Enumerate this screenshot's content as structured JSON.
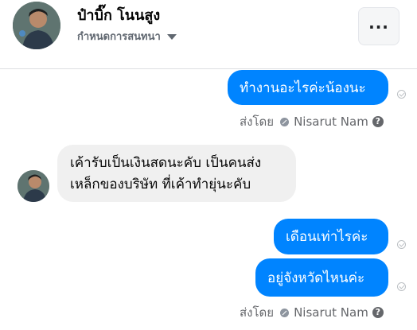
{
  "header": {
    "name": "ป๋าบิ๊ก โนนสูง",
    "subtitle": "กำหนดการสนทนา",
    "menu_icon": "more-horizontal-icon"
  },
  "messages": {
    "out_1": "ทำงานอะไรค่ะน้องนะ",
    "in_1_line_1": "เค้ารับเป็นเงินสดนะคับ เป็นคนส่ง",
    "in_1_line_2": "เหล็กของบริษัท ที่เค้าทำยุ่นะคับ",
    "out_2": "เดือนเท่าไรค่ะ",
    "out_3": "อยู่จังหวัดไหนค่ะ"
  },
  "sent_by": {
    "prefix": "ส่งโดย",
    "name": "Nisarut Nam"
  },
  "colors": {
    "outgoing_bubble": "#0084ff",
    "incoming_bubble": "#f0f0f0"
  }
}
